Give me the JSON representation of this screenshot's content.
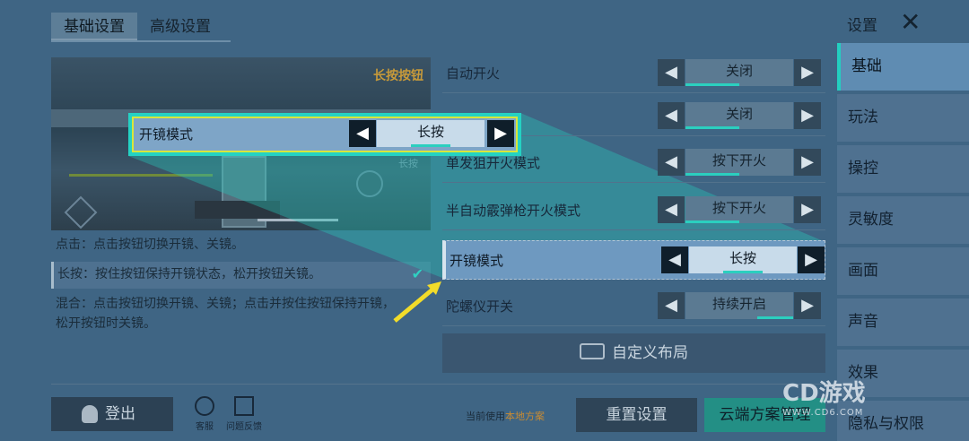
{
  "tabs": [
    {
      "label": "基础设置",
      "active": true
    },
    {
      "label": "高级设置",
      "active": false
    }
  ],
  "preview": {
    "button_tag": "长按按钮",
    "small_tag": "长按"
  },
  "descriptions": {
    "tap": "点击：点击按钮切换开镜、关镜。",
    "hold": "长按：按住按钮保持开镜状态，松开按钮关镜。",
    "mix": "混合：点击按钮切换开镜、关镜；点击并按住按钮保持开镜，松开按钮时关镜。"
  },
  "settings": [
    {
      "label": "自动开火",
      "value": "关闭",
      "level": 0.5
    },
    {
      "label": "",
      "value": "关闭",
      "level": 0.5
    },
    {
      "label": "单发狙开火模式",
      "value": "按下开火",
      "level": 0.5
    },
    {
      "label": "半自动霰弹枪开火模式",
      "value": "按下开火",
      "level": 0.5
    },
    {
      "label": "开镜模式",
      "value": "长按",
      "level": 0.5,
      "highlighted": true
    },
    {
      "label": "陀螺仪开关",
      "value": "持续开启",
      "level": 0.8
    }
  ],
  "callout": {
    "label": "开镜模式",
    "value": "长按"
  },
  "custom_layout_label": "自定义布局",
  "header": {
    "title": "设置",
    "close": "✕"
  },
  "nav": [
    {
      "label": "基础",
      "active": true
    },
    {
      "label": "玩法"
    },
    {
      "label": "操控"
    },
    {
      "label": "灵敏度"
    },
    {
      "label": "画面"
    },
    {
      "label": "声音"
    },
    {
      "label": "效果"
    },
    {
      "label": "隐私与权限"
    }
  ],
  "bottom": {
    "logout": "登出",
    "service": "客服",
    "feedback": "问题反馈",
    "current_prefix": "当前使用",
    "current_scheme": "本地方案",
    "reset": "重置设置",
    "cloud": "云端方案管理"
  },
  "watermark": {
    "big": "CD游戏",
    "small": "WWW.CD6.COM"
  },
  "colors": {
    "accent": "#23cfc0",
    "callout_border": "#24d2c3",
    "arrow": "#f2dc2a"
  }
}
